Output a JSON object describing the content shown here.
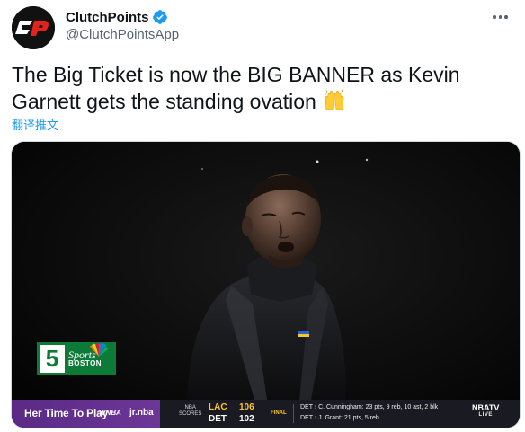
{
  "tweet": {
    "display_name": "ClutchPoints",
    "handle": "@ClutchPointsApp",
    "avatar_text": "CP",
    "text": "The Big Ticket is now the BIG BANNER as Kevin Garnett gets the standing ovation",
    "emoji": "raised-hands",
    "translate_label": "翻译推文"
  },
  "media": {
    "channel": {
      "number": "5",
      "line1": "Sports",
      "line2": "BOSTON"
    },
    "ticker": {
      "promo_title": "Her Time To Play",
      "promo_brand": "WNBA",
      "promo_brand2": "jr.nba",
      "scores_label_line1": "NBA",
      "scores_label_line2": "SCORES",
      "teams": [
        {
          "abbr": "LAC",
          "score": "106"
        },
        {
          "abbr": "DET",
          "score": "102"
        }
      ],
      "status": "FINAL",
      "notes": [
        "DET › C. Cunningham: 23 pts, 9 reb, 10 ast, 2 blk",
        "DET › J. Grant: 21 pts, 5 reb"
      ],
      "network": "NBATV",
      "network_sub": "LIVE"
    }
  },
  "colors": {
    "accent": "#1d9bf0",
    "promo": "#6d3698",
    "score_highlight": "#ffc629",
    "channel_green": "#0e7a38"
  }
}
